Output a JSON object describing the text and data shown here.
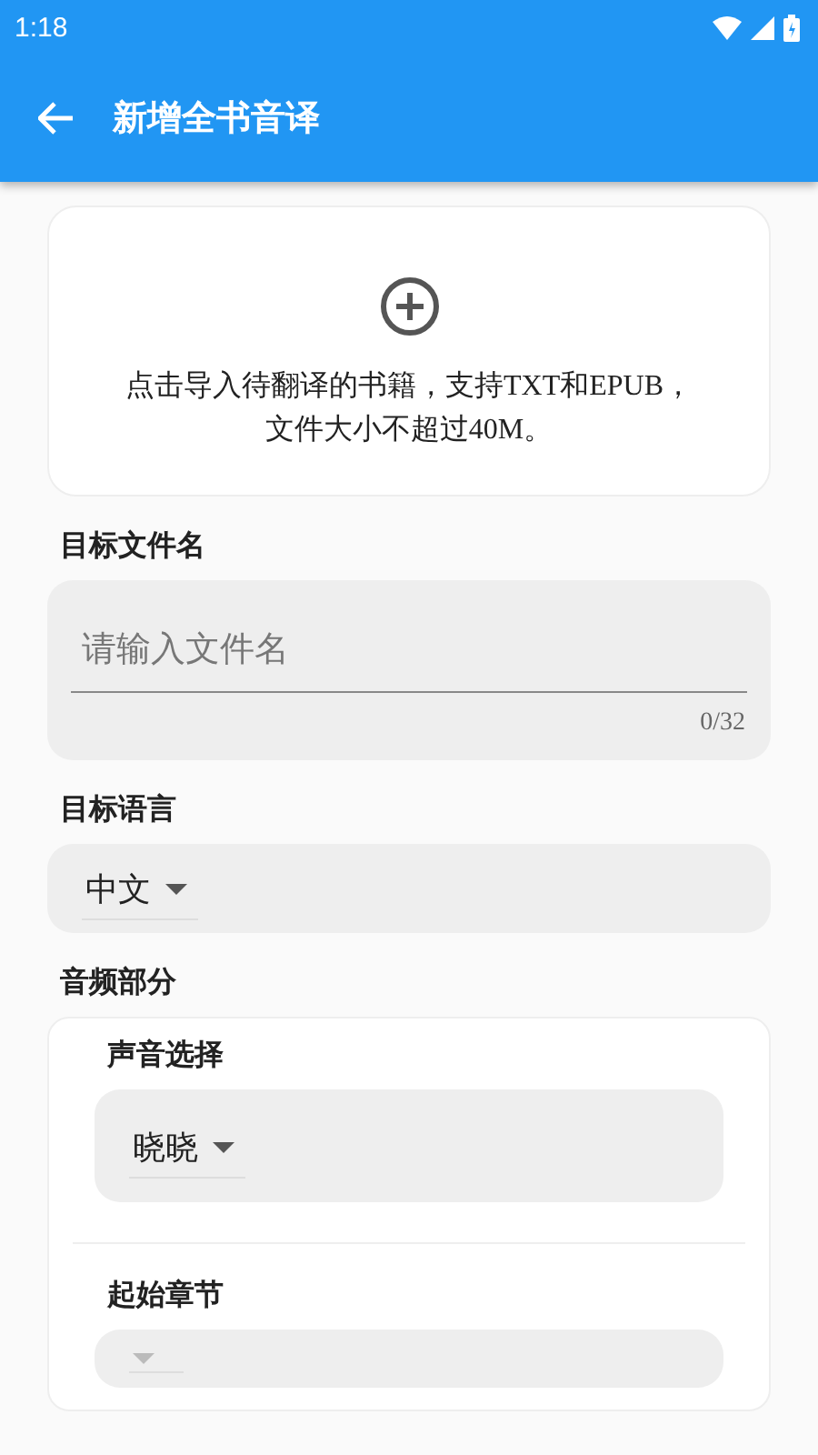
{
  "status_bar": {
    "time": "1:18"
  },
  "toolbar": {
    "title": "新增全书音译"
  },
  "upload": {
    "lines": [
      "点击导入待翻译的书籍，支持TXT和EPUB，",
      "文件大小不超过40M。"
    ]
  },
  "file_name": {
    "label": "目标文件名",
    "placeholder": "请输入文件名",
    "counter": "0/32"
  },
  "language": {
    "label": "目标语言",
    "value": "中文"
  },
  "audio": {
    "label": "音频部分",
    "fields": [
      {
        "label": "声音选择",
        "value": "晓晓",
        "disabled": false
      },
      {
        "label": "起始章节",
        "disabled": true
      }
    ]
  }
}
